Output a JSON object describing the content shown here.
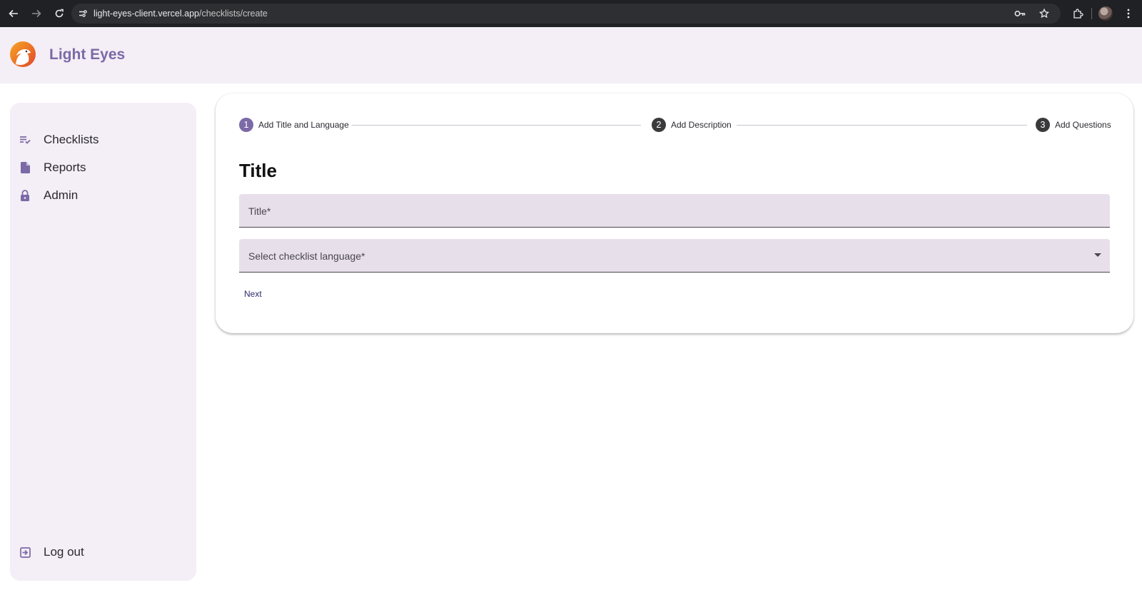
{
  "browser": {
    "url_host": "light-eyes-client.vercel.app",
    "url_path": "/checklists/create",
    "icons": [
      "back-arrow-icon",
      "forward-arrow-icon",
      "reload-icon",
      "site-info-icon",
      "key-icon",
      "star-icon",
      "extensions-icon",
      "profile-avatar",
      "more-vert-icon"
    ]
  },
  "header": {
    "app_title": "Light Eyes"
  },
  "sidebar": {
    "items": [
      {
        "label": "Checklists",
        "icon": "playlist-check-icon"
      },
      {
        "label": "Reports",
        "icon": "document-icon"
      },
      {
        "label": "Admin",
        "icon": "lock-icon"
      }
    ],
    "logout": {
      "label": "Log out",
      "icon": "logout-icon"
    }
  },
  "stepper": {
    "steps": [
      {
        "number": "1",
        "label": "Add Title and Language",
        "state": "active"
      },
      {
        "number": "2",
        "label": "Add Description",
        "state": "inactive"
      },
      {
        "number": "3",
        "label": "Add Questions",
        "state": "inactive"
      }
    ]
  },
  "form": {
    "section_title": "Title",
    "title_field": {
      "placeholder": "Title*",
      "value": ""
    },
    "language_select": {
      "placeholder": "Select checklist language*",
      "value": ""
    },
    "next_label": "Next"
  },
  "colors": {
    "accent": "#7b6aa6",
    "surface": "#f4eef6",
    "field_bg": "#e7e0ea",
    "browser_bar": "#202124"
  }
}
